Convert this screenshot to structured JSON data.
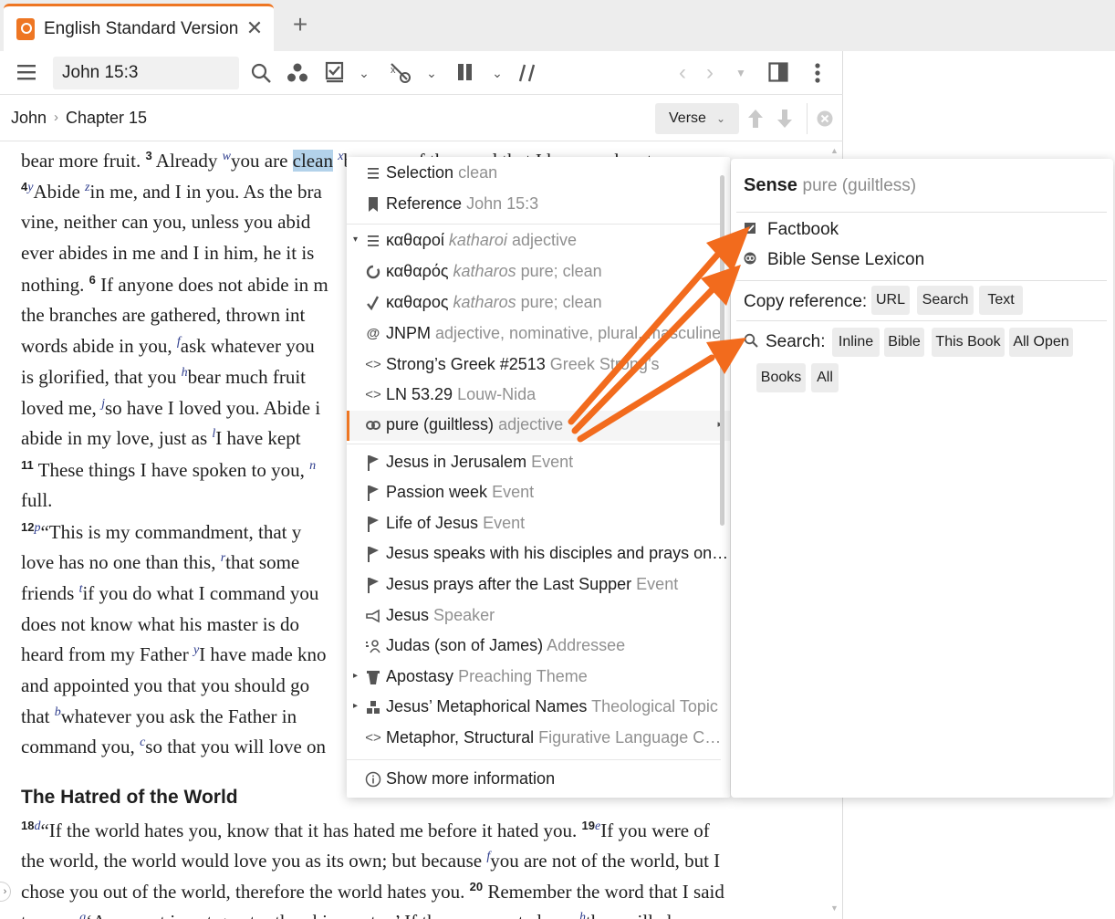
{
  "tab": {
    "title": "English Standard Version",
    "close": "✕",
    "add": "+"
  },
  "toolbar": {
    "reference": "John 15:3",
    "icons": [
      "menu-icon",
      "search-icon",
      "visual-filter-icon",
      "checklist-icon",
      "interlinear-icon",
      "layout-icon",
      "parallel-icon",
      "back-icon",
      "forward-icon",
      "panel-icon",
      "more-icon"
    ]
  },
  "navbar": {
    "book": "John",
    "separator": "›",
    "chapter": "Chapter 15",
    "verse_button": "Verse",
    "verse_chevron": "⌄"
  },
  "text": {
    "l1": {
      "a": "bear more fruit. ",
      "v3": "3",
      "b": " Already ",
      "fw": "w",
      "c": "you are ",
      "hl": "clean",
      "d": " ",
      "fx": "x",
      "e": "because of the word that I have spoken to you."
    },
    "l2": {
      "v4": "4",
      "fy": "y",
      "a": "Abide ",
      "fz": "z",
      "b": "in me, and I in you. As the bra"
    },
    "l3": "vine, neither can you, unless you abid",
    "l4": "ever abides in me and I in him, he it is",
    "l5": {
      "a": "nothing. ",
      "v6": "6",
      "b": " If anyone does not abide in m"
    },
    "l6": "the branches are gathered, thrown int",
    "l7": {
      "a": "words abide in you, ",
      "ff": "f",
      "b": "ask whatever you"
    },
    "l8": {
      "a": "is glorified, that you ",
      "fh": "h",
      "b": "bear much fruit"
    },
    "l9": {
      "a": "loved me, ",
      "fj": "j",
      "b": "so have I loved you. Abide i"
    },
    "l10": {
      "a": "abide in my love, just as ",
      "fl": "l",
      "b": "I have kept"
    },
    "l11": {
      "v11": "11",
      "a": " These things I have spoken to you, ",
      "fn": "n"
    },
    "l12": "full.",
    "l13": {
      "v12": "12",
      "fp": "p",
      "a": "“This is my commandment, that y"
    },
    "l14": {
      "a": "love has no one than this, ",
      "fr": "r",
      "b": "that some"
    },
    "l15": {
      "a": "friends ",
      "ft": "t",
      "b": "if you do what I command you"
    },
    "l16": "does not know what his master is do",
    "l17": {
      "a": "heard from my Father ",
      "fy": "y",
      "b": "I have made kno"
    },
    "l18": "and appointed you that you should go",
    "l19": {
      "a": "that ",
      "fb": "b",
      "b": "whatever you ask the Father in"
    },
    "l20": {
      "a": "command you, ",
      "fc": "c",
      "b": "so that you will love on"
    },
    "heading": "The Hatred of the World",
    "l21": {
      "v18": "18",
      "fd": "d",
      "a": "“If the world hates you, know that it has hated me before it hated you. ",
      "v19": "19",
      "fe": "e",
      "b": "If you were of"
    },
    "l22": {
      "a": "the world, the world would love you as its own; but because ",
      "ff": "f",
      "b": "you are not of the world, but I"
    },
    "l23": {
      "a": "chose you out of the world, therefore the world hates you. ",
      "v20": "20",
      "b": " Remember the word that I said"
    },
    "l24": {
      "a": "to you: ",
      "fg": "g",
      "b": "‘A servant is not greater than his master.’ If they persecuted me, ",
      "fh": "h",
      "c": "they will also per"
    }
  },
  "menu": {
    "items": [
      {
        "label": "Selection",
        "sub": "clean",
        "icon": "selection-icon"
      },
      {
        "label": "Reference",
        "sub": "John 15:3",
        "icon": "bookmark-icon"
      },
      {
        "label": "καθαροί",
        "subi": "katharoi",
        "sub": "adjective",
        "icon": "lines-icon",
        "caret": "▾"
      },
      {
        "label": "καθαρός",
        "subi": "katharos",
        "sub": "pure; clean",
        "icon": "lemma-icon"
      },
      {
        "label": "καθαρος",
        "subi": "katharos",
        "sub": "pure; clean",
        "icon": "root-icon"
      },
      {
        "label": "JNPM",
        "sub": "adjective, nominative, plural, masculine",
        "icon": "morph-icon"
      },
      {
        "label": "Strong’s Greek #2513",
        "sub": "Greek Strong’s",
        "icon": "code-icon"
      },
      {
        "label": "LN 53.29",
        "sub": "Louw-Nida",
        "icon": "code-icon"
      },
      {
        "label": "pure (guiltless)",
        "sub": "adjective",
        "icon": "sense-icon",
        "arrow": "▸"
      },
      {
        "label": "Jesus in Jerusalem",
        "sub": "Event",
        "icon": "flag-icon"
      },
      {
        "label": "Passion week",
        "sub": "Event",
        "icon": "flag-icon"
      },
      {
        "label": "Life of Jesus",
        "sub": "Event",
        "icon": "flag-icon"
      },
      {
        "label": "Jesus speaks with his disciples and prays on…",
        "sub": "",
        "icon": "flag-icon"
      },
      {
        "label": "Jesus prays after the Last Supper",
        "sub": "Event",
        "icon": "flag-icon"
      },
      {
        "label": "Jesus",
        "sub": "Speaker",
        "icon": "megaphone-icon"
      },
      {
        "label": "Judas (son of James)",
        "sub": "Addressee",
        "icon": "addressee-icon"
      },
      {
        "label": "Apostasy",
        "sub": "Preaching Theme",
        "icon": "podium-icon",
        "caret": "▸"
      },
      {
        "label": "Jesus’ Metaphorical Names",
        "sub": "Theological Topic",
        "icon": "topic-icon",
        "caret": "▸"
      },
      {
        "label": "Metaphor, Structural",
        "sub": "Figurative Language C…",
        "icon": "code-icon"
      }
    ],
    "footer": "Show more information"
  },
  "subpanel": {
    "title": "Sense",
    "title_sub": "pure (guiltless)",
    "factbook": "Factbook",
    "lexicon": "Bible Sense Lexicon",
    "copy_label": "Copy reference:",
    "copy": [
      "URL",
      "Search",
      "Text"
    ],
    "search_label": "Search:",
    "search": [
      "Inline",
      "Bible",
      "This Book",
      "All Open",
      "Books",
      "All"
    ]
  },
  "colors": {
    "accent": "#ee7623",
    "arrow": "#f26b1d",
    "highlight": "#b3d2ea",
    "footnote": "#2c3b8c"
  }
}
